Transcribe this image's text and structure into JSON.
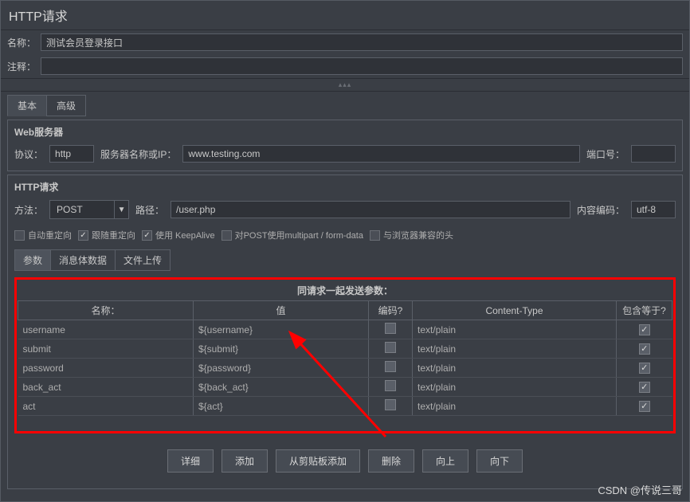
{
  "window": {
    "title": "HTTP请求"
  },
  "fields": {
    "name_label": "名称：",
    "name_value": "测试会员登录接口",
    "comment_label": "注释：",
    "comment_value": ""
  },
  "tabs": {
    "basic": "基本",
    "advanced": "高级"
  },
  "web_server": {
    "group_title": "Web服务器",
    "protocol_label": "协议：",
    "protocol_value": "http",
    "server_label": "服务器名称或IP：",
    "server_value": "www.testing.com",
    "port_label": "端口号：",
    "port_value": ""
  },
  "http_request": {
    "group_title": "HTTP请求",
    "method_label": "方法：",
    "method_value": "POST",
    "path_label": "路径：",
    "path_value": "/user.php",
    "encoding_label": "内容编码：",
    "encoding_value": "utf-8",
    "checkboxes": {
      "auto_redirect": {
        "label": "自动重定向",
        "checked": false
      },
      "follow_redirect": {
        "label": "跟随重定向",
        "checked": true
      },
      "keepalive": {
        "label": "使用 KeepAlive",
        "checked": true
      },
      "multipart": {
        "label": "对POST使用multipart / form-data",
        "checked": false
      },
      "browser_headers": {
        "label": "与浏览器兼容的头",
        "checked": false
      }
    }
  },
  "sub_tabs": {
    "params": "参数",
    "body": "消息体数据",
    "upload": "文件上传"
  },
  "params_panel": {
    "title": "同请求一起发送参数：",
    "headers": {
      "name": "名称：",
      "value": "值",
      "encode": "编码?",
      "content_type": "Content-Type",
      "include_equals": "包含等于?"
    },
    "rows": [
      {
        "name": "username",
        "value": "${username}",
        "encode": false,
        "content_type": "text/plain",
        "include_equals": true
      },
      {
        "name": "submit",
        "value": "${submit}",
        "encode": false,
        "content_type": "text/plain",
        "include_equals": true
      },
      {
        "name": "password",
        "value": "${password}",
        "encode": false,
        "content_type": "text/plain",
        "include_equals": true
      },
      {
        "name": "back_act",
        "value": "${back_act}",
        "encode": false,
        "content_type": "text/plain",
        "include_equals": true
      },
      {
        "name": "act",
        "value": "${act}",
        "encode": false,
        "content_type": "text/plain",
        "include_equals": true
      }
    ]
  },
  "buttons": {
    "detail": "详细",
    "add": "添加",
    "add_clipboard": "从剪贴板添加",
    "delete": "删除",
    "up": "向上",
    "down": "向下"
  },
  "watermark": "CSDN @传说三哥"
}
